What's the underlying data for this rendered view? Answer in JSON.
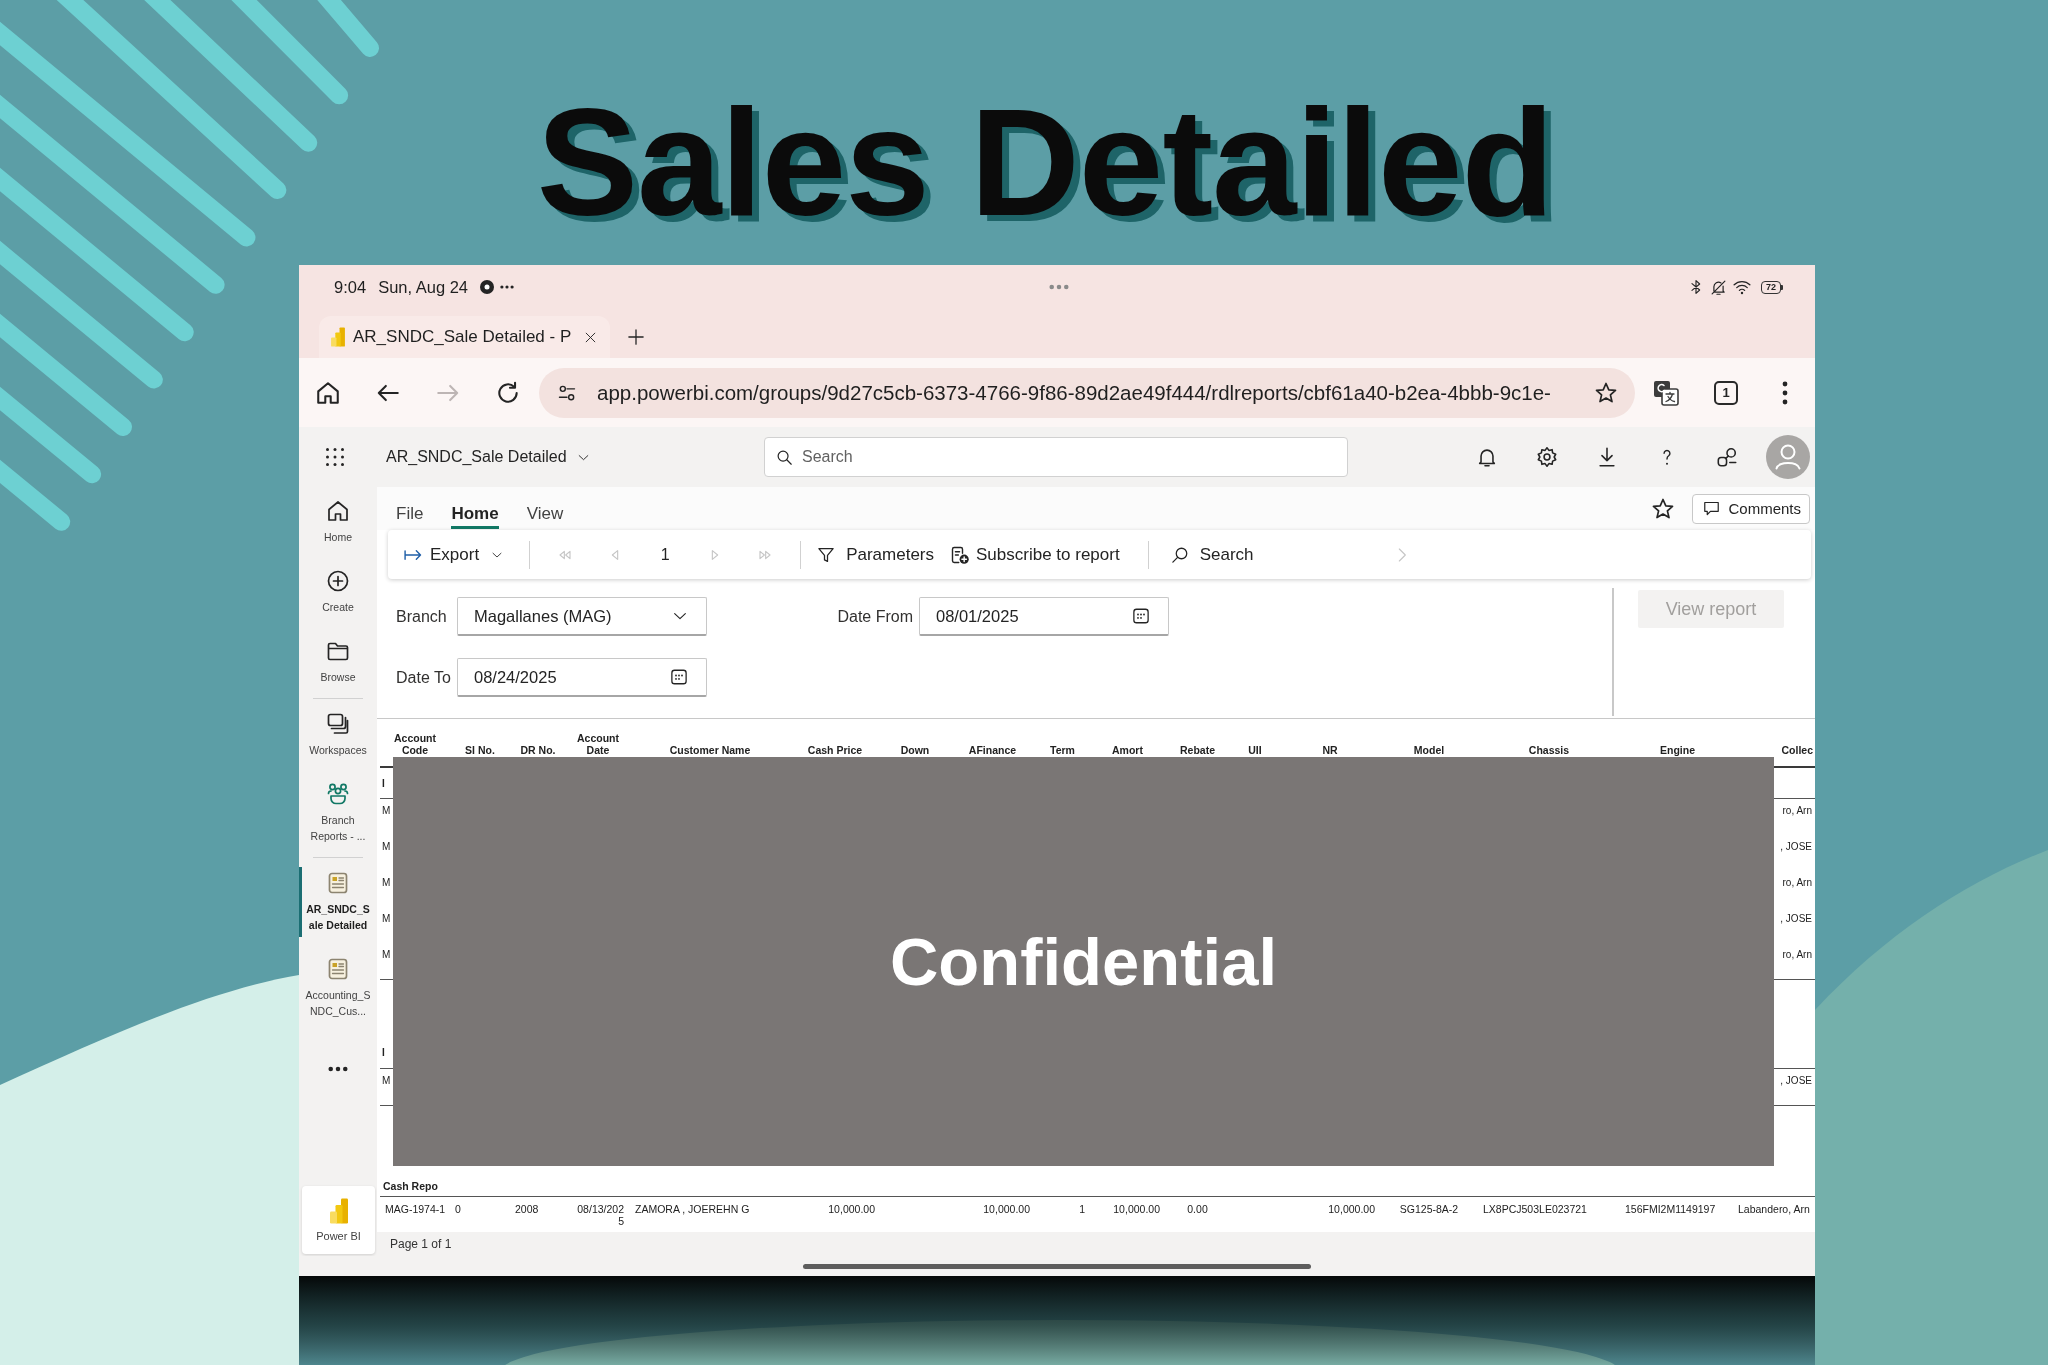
{
  "title": "Sales Detailed",
  "status_bar": {
    "time": "9:04",
    "date": "Sun, Aug 24",
    "battery": "72"
  },
  "browser": {
    "tab": {
      "title": "AR_SNDC_Sale Detailed - P"
    },
    "nav": [
      {
        "kind": "home",
        "disabled": false
      },
      {
        "kind": "back",
        "disabled": false
      },
      {
        "kind": "forward",
        "disabled": true
      },
      {
        "kind": "reload",
        "disabled": false
      }
    ],
    "url": "app.powerbi.com/groups/9d27c5cb-6373-4766-9f86-89d2ae49f444/rdlreports/cbf61a40-b2ea-4bbb-9c1e-",
    "tab_count": "1"
  },
  "app_header": {
    "report_name": "AR_SNDC_Sale Detailed",
    "search": {
      "placeholder": "Search"
    }
  },
  "sidebar": {
    "items": [
      {
        "kind": "home",
        "label": "Home",
        "selected": false
      },
      {
        "kind": "create",
        "label": "Create",
        "selected": false
      },
      {
        "kind": "browse",
        "label": "Browse",
        "selected": false
      },
      {
        "kind": "divider"
      },
      {
        "kind": "workspaces",
        "label": "Workspaces",
        "selected": false
      },
      {
        "kind": "app",
        "label": "Branch Reports - ...",
        "selected": false
      },
      {
        "kind": "divider"
      },
      {
        "kind": "report",
        "label": "AR_SNDC_Sale Detailed",
        "selected": true
      },
      {
        "kind": "report",
        "label": "Accounting_SNDC_Cus...",
        "selected": false
      },
      {
        "kind": "more"
      }
    ],
    "footer": "Power BI"
  },
  "ribbon": {
    "tabs": [
      {
        "label": "File",
        "selected": false
      },
      {
        "label": "Home",
        "selected": true
      },
      {
        "label": "View",
        "selected": false
      }
    ],
    "comments": "Comments",
    "toolbar": {
      "export": "Export",
      "pager": [
        {
          "kind": "first",
          "disabled": true
        },
        {
          "kind": "previous",
          "disabled": true
        },
        {
          "kind": "next",
          "disabled": true
        },
        {
          "kind": "last",
          "disabled": true
        }
      ],
      "page": "1",
      "actions": [
        {
          "kind": "parameters",
          "label": "Parameters"
        },
        {
          "kind": "subscribe",
          "label": "Subscribe to report"
        },
        {
          "kind": "search",
          "label": "Search"
        }
      ]
    }
  },
  "parameters": {
    "fields": [
      {
        "kind": "dropdown",
        "label": "Branch",
        "value": "Magallanes (MAG)"
      },
      {
        "kind": "date",
        "label": "Date From",
        "value": "08/01/2025"
      },
      {
        "kind": "date",
        "label": "Date To",
        "value": "08/24/2025"
      }
    ],
    "view_report": {
      "label": "View report",
      "disabled": true
    }
  },
  "table": {
    "columns": [
      "Account Code",
      "SI No.",
      "DR No.",
      "Account Date",
      "Customer Name",
      "Cash Price",
      "Down",
      "AFinance",
      "Term",
      "Amort",
      "Rebate",
      "UII",
      "NR",
      "Model",
      "Chassis",
      "Engine",
      "Collec"
    ],
    "redacted": {
      "label": "Confidential",
      "rows": [
        {
          "kind": "group",
          "left": "I"
        },
        {
          "kind": "row",
          "left": "M",
          "right": "ro, Arn"
        },
        {
          "kind": "row",
          "left": "M",
          "right": ", JOSE"
        },
        {
          "kind": "row",
          "left": "M",
          "right": "ro, Arn"
        },
        {
          "kind": "row",
          "left": "M",
          "right": ", JOSE"
        },
        {
          "kind": "row",
          "left": "M",
          "right": "ro, Arn"
        },
        {
          "kind": "group",
          "left": "I"
        },
        {
          "kind": "row",
          "left": "M",
          "right": ", JOSE"
        }
      ]
    },
    "groups": [
      {
        "name": "Cash Repo",
        "rows": [
          {
            "cells": [
              "MAG-1974-1",
              "0",
              "2008",
              "08/13/2025",
              "ZAMORA , JOEREHN G",
              "10,000.00",
              null,
              "10,000.00",
              "1",
              "10,000.00",
              "0.00",
              null,
              "10,000.00",
              "SG125-8A-2",
              "LX8PCJ503LE023721",
              "156FMI2M1149197",
              "Labandero, Arn"
            ]
          }
        ]
      }
    ]
  },
  "footer": {
    "page_info": "Page 1 of 1"
  }
}
